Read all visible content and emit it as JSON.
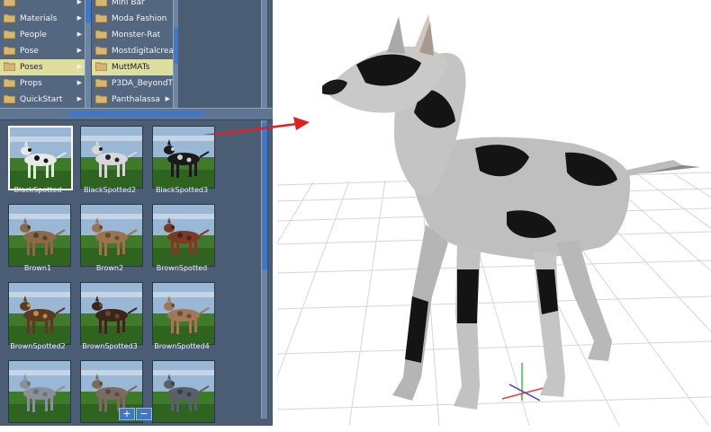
{
  "category_list": [
    {
      "label": "",
      "arrow": "▶"
    },
    {
      "label": "Materials",
      "arrow": "▶"
    },
    {
      "label": "People",
      "arrow": "▶"
    },
    {
      "label": "Pose",
      "arrow": "▶"
    },
    {
      "label": "Poses",
      "arrow": "▶",
      "selected": true
    },
    {
      "label": "Props",
      "arrow": "▶"
    },
    {
      "label": "QuickStart",
      "arrow": "▶"
    }
  ],
  "subfolder_list": [
    {
      "label": "Mini Bar",
      "arrow": ""
    },
    {
      "label": "Moda Fashion",
      "arrow": ""
    },
    {
      "label": "Monster-Rat",
      "arrow": ""
    },
    {
      "label": "Mostdigitalcreati",
      "arrow": ""
    },
    {
      "label": "MuttMATs",
      "arrow": "",
      "selected": true
    },
    {
      "label": "P3DA_BeyondTheS",
      "arrow": ""
    },
    {
      "label": "Panthalassa",
      "arrow": "▶"
    }
  ],
  "thumbnails": [
    {
      "label": "BlackSpotted",
      "coat": "blackspotted",
      "selected": true
    },
    {
      "label": "BlackSpotted2",
      "coat": "dalmatian"
    },
    {
      "label": "BlackSpotted3",
      "coat": "blackwhite"
    },
    {
      "label": "Brown1",
      "coat": "brown1"
    },
    {
      "label": "Brown2",
      "coat": "brown2"
    },
    {
      "label": "BrownSpotted",
      "coat": "reddish"
    },
    {
      "label": "BrownSpotted2",
      "coat": "brindle"
    },
    {
      "label": "BrownSpotted3",
      "coat": "darkbrown"
    },
    {
      "label": "BrownSpotted4",
      "coat": "tan"
    },
    {
      "label": "",
      "coat": "grey"
    },
    {
      "label": "",
      "coat": "greybrown"
    },
    {
      "label": "",
      "coat": "darkgrey"
    }
  ],
  "buttons": {
    "add_label": "+",
    "remove_label": "−"
  },
  "colors": {
    "panel": "#4a5d75",
    "selected_row": "#dede9e",
    "scroll_thumb": "#3f78c8",
    "arrow": "#e02020"
  }
}
